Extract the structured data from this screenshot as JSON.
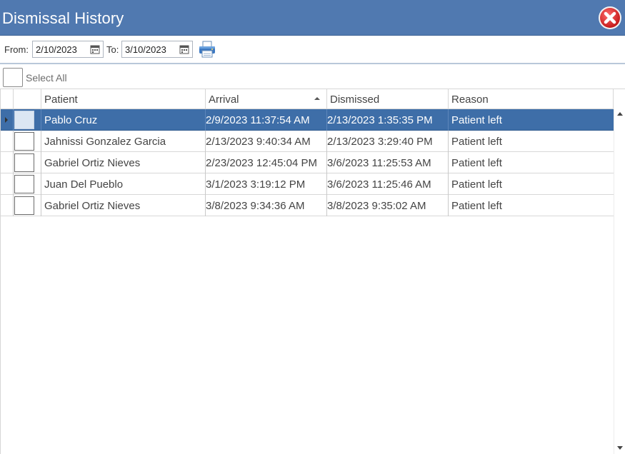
{
  "window": {
    "title": "Dismissal History",
    "close_icon": "close-icon"
  },
  "toolbar": {
    "from_label": "From:",
    "from_value": "2/10/2023",
    "to_label": "To:",
    "to_value": "3/10/2023",
    "print_icon": "printer-icon"
  },
  "select_all": {
    "label": "Select All",
    "checked": false
  },
  "grid": {
    "columns": [
      "Patient",
      "Arrival",
      "Dismissed",
      "Reason"
    ],
    "sorted_column": "Arrival",
    "sort_direction": "ascending",
    "rows": [
      {
        "patient": "Pablo Cruz",
        "arrival": "2/9/2023 11:37:54 AM",
        "dismissed": "2/13/2023 1:35:35 PM",
        "reason": "Patient left",
        "selected": true
      },
      {
        "patient": "Jahnissi Gonzalez Garcia",
        "arrival": "2/13/2023 9:40:34 AM",
        "dismissed": "2/13/2023 3:29:40 PM",
        "reason": "Patient left",
        "selected": false
      },
      {
        "patient": "Gabriel Ortiz Nieves",
        "arrival": "2/23/2023 12:45:04 PM",
        "dismissed": "3/6/2023 11:25:53 AM",
        "reason": "Patient left",
        "selected": false
      },
      {
        "patient": "Juan Del Pueblo",
        "arrival": "3/1/2023 3:19:12 PM",
        "dismissed": "3/6/2023 11:25:46 AM",
        "reason": "Patient left",
        "selected": false
      },
      {
        "patient": "Gabriel Ortiz Nieves",
        "arrival": "3/8/2023 9:34:36 AM",
        "dismissed": "3/8/2023 9:35:02 AM",
        "reason": "Patient left",
        "selected": false
      }
    ]
  },
  "colors": {
    "titlebar": "#5079b0",
    "selected_row": "#3e6ea8",
    "close_red": "#d42a2a"
  }
}
